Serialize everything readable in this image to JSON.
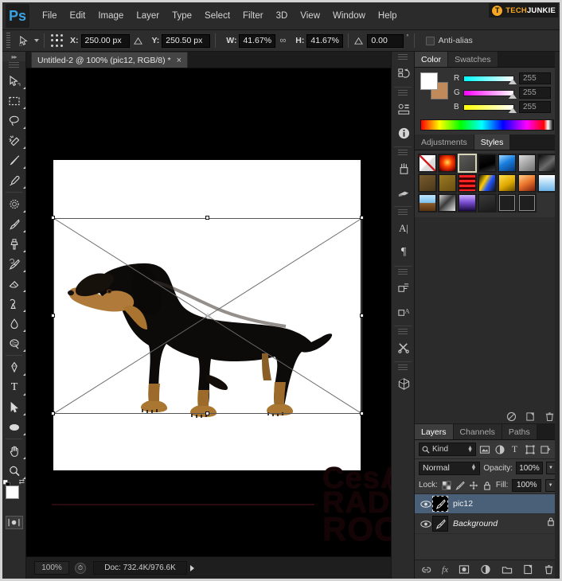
{
  "app": {
    "name": "Adobe Photoshop",
    "logo_text": "Ps",
    "brand_tech": "TECH",
    "brand_junkie": "JUNKIE",
    "brand_mark": "T"
  },
  "menu": {
    "items": [
      "File",
      "Edit",
      "Image",
      "Layer",
      "Type",
      "Select",
      "Filter",
      "3D",
      "View",
      "Window",
      "Help"
    ]
  },
  "options_bar": {
    "tool": "move-tool",
    "x_label": "X:",
    "x_value": "250.00 px",
    "y_label": "Y:",
    "y_value": "250.50 px",
    "w_label": "W:",
    "w_value": "41.67%",
    "h_label": "H:",
    "h_value": "41.67%",
    "link_symbol": "∞",
    "angle_value": "0.00",
    "degree_symbol": "°",
    "antialias_label": "Anti-alias",
    "antialias_checked": false
  },
  "document": {
    "tab_title": "Untitled-2 @ 100% (pic12, RGB/8) *",
    "close_symbol": "×"
  },
  "status_bar": {
    "zoom": "100%",
    "doc_info": "Doc: 732.4K/976.6K"
  },
  "canvas": {
    "watermark_line1": "CesAr",
    "watermark_line2": "RADIO",
    "watermark_line3": "ROCK",
    "image_subject": "dachshund-dog"
  },
  "toolbar": {
    "tools": [
      {
        "name": "move-tool",
        "label": "Move Tool"
      },
      {
        "name": "marquee-tool",
        "label": "Rectangular Marquee Tool"
      },
      {
        "name": "lasso-tool",
        "label": "Lasso Tool"
      },
      {
        "name": "quick-selection-tool",
        "label": "Quick Selection Tool"
      },
      {
        "name": "crop-tool",
        "label": "Crop Tool"
      },
      {
        "name": "eyedropper-tool",
        "label": "Eyedropper Tool"
      },
      {
        "name": "spot-healing-tool",
        "label": "Spot Healing Brush Tool"
      },
      {
        "name": "brush-tool",
        "label": "Brush Tool"
      },
      {
        "name": "clone-stamp-tool",
        "label": "Clone Stamp Tool"
      },
      {
        "name": "history-brush-tool",
        "label": "History Brush Tool"
      },
      {
        "name": "eraser-tool",
        "label": "Eraser Tool"
      },
      {
        "name": "gradient-tool",
        "label": "Gradient Tool"
      },
      {
        "name": "blur-tool",
        "label": "Blur Tool"
      },
      {
        "name": "dodge-tool",
        "label": "Dodge Tool"
      },
      {
        "name": "pen-tool",
        "label": "Pen Tool"
      },
      {
        "name": "type-tool",
        "label": "Horizontal Type Tool"
      },
      {
        "name": "path-selection-tool",
        "label": "Path Selection Tool"
      },
      {
        "name": "ellipse-tool",
        "label": "Ellipse Tool"
      },
      {
        "name": "hand-tool",
        "label": "Hand Tool"
      },
      {
        "name": "zoom-tool",
        "label": "Zoom Tool"
      }
    ],
    "type_glyph": "T",
    "foreground_color": "#ffffff",
    "background_color": "#c08a5a",
    "quick_mask_label": "Edit in Quick Mask Mode"
  },
  "icon_dock": {
    "items": [
      {
        "name": "history-icon"
      },
      {
        "name": "actions-icon"
      },
      {
        "name": "info-icon"
      },
      {
        "name": "brush-presets-icon"
      },
      {
        "name": "brush-settings-icon"
      },
      {
        "name": "character-icon",
        "glyph": "A|"
      },
      {
        "name": "paragraph-icon",
        "glyph": "¶"
      },
      {
        "name": "character-styles-icon"
      },
      {
        "name": "paragraph-styles-icon"
      },
      {
        "name": "tool-presets-icon"
      },
      {
        "name": "3d-icon"
      }
    ]
  },
  "color_panel": {
    "tabs": [
      {
        "label": "Color",
        "active": true
      },
      {
        "label": "Swatches",
        "active": false
      }
    ],
    "channels": [
      {
        "label": "R",
        "value": "255"
      },
      {
        "label": "G",
        "value": "255"
      },
      {
        "label": "B",
        "value": "255"
      }
    ],
    "foreground_color": "#ffffff",
    "background_color": "#c08a5a"
  },
  "styles_panel": {
    "tabs": [
      {
        "label": "Adjustments",
        "active": false
      },
      {
        "label": "Styles",
        "active": true
      }
    ],
    "swatches": [
      {
        "name": "default-none-style",
        "css": "linear-gradient(135deg,#ffffff 0%,#ffffff 45%,#e0e0e0 55%,#cfcfcf 100%)",
        "selected": false,
        "slash": true
      },
      {
        "name": "red-glow-style",
        "css": "radial-gradient(circle at 50% 45%,#ffdd55 0%,#ff4400 38%,#aa1100 72%,#220000 100%)",
        "selected": false
      },
      {
        "name": "gray-bevel-style",
        "css": "linear-gradient(145deg,#5a5a58 0%,#3a3a38 100%)",
        "selected": true
      },
      {
        "name": "black-splatter-style",
        "css": "linear-gradient(160deg,#111111 0%,#000000 60%,#3a3a3a 100%)",
        "selected": false
      },
      {
        "name": "blue-gel-style",
        "css": "linear-gradient(150deg,#9fd8ff 0%,#1a7fe0 45%,#063a7a 100%)",
        "selected": false
      },
      {
        "name": "silver-style",
        "css": "linear-gradient(145deg,#dcdcdc 0%,#9a9a9a 60%,#6e6e6e 100%)",
        "selected": false
      },
      {
        "name": "dark-chrome-style",
        "css": "linear-gradient(140deg,#0a0a0a 0%,#6a6a6a 55%,#111111 100%)",
        "selected": false
      },
      {
        "name": "brown-texture-style",
        "css": "linear-gradient(150deg,#7a5c2e 0%,#4a3718 100%)",
        "selected": false
      },
      {
        "name": "gold-texture-style",
        "css": "linear-gradient(150deg,#9b7a25 0%,#6a5010 100%)",
        "selected": false
      },
      {
        "name": "red-stripes-style",
        "css": "repeating-linear-gradient(to bottom,#ff2222 0 3px,#440000 3px 6px)",
        "selected": false
      },
      {
        "name": "colorful-splash-style",
        "css": "linear-gradient(120deg,#111111 0%,#ffcc00 35%,#2255ff 60%,#111111 100%)",
        "selected": false
      },
      {
        "name": "yellow-bevel-style",
        "css": "linear-gradient(150deg,#ffe14d 0%,#e0a800 55%,#6b4e00 100%)",
        "selected": false
      },
      {
        "name": "sunset-gradient-style",
        "css": "linear-gradient(150deg,#ffd08a 0%,#e8722a 50%,#7a2010 100%)",
        "selected": false
      },
      {
        "name": "light-blue-style",
        "css": "linear-gradient(to bottom,#ffffff 0%,#a9d6f5 55%,#6fb3e8 100%)",
        "selected": false
      },
      {
        "name": "sky-horizon-style",
        "css": "linear-gradient(to bottom,#bfe4ff 0%,#7fc4ef 48%,#8a5a2a 52%,#5a3310 100%)",
        "selected": false
      },
      {
        "name": "noise-texture-style",
        "css": "linear-gradient(135deg,#cfcfcf 0%,#3a3a3a 45%,#e8e8e8 100%)",
        "selected": false
      },
      {
        "name": "purple-gradient-style",
        "css": "linear-gradient(to bottom,#cdb0ff 0%,#7b4fd4 45%,#1a0840 100%)",
        "selected": false
      },
      {
        "name": "dark-square-style",
        "css": "linear-gradient(160deg,#3a3a3a 0%,#1a1a1a 100%)",
        "selected": false
      },
      {
        "name": "outline-square-style",
        "css": "#1f1f1f",
        "selected": false,
        "outline": true
      },
      {
        "name": "outline-square-2-style",
        "css": "#1f1f1f",
        "selected": false,
        "outline": true
      },
      {
        "name": "empty-style",
        "css": "transparent",
        "selected": false,
        "empty": true
      }
    ]
  },
  "layers_panel": {
    "tabs": [
      {
        "label": "Layers",
        "active": true
      },
      {
        "label": "Channels",
        "active": false
      },
      {
        "label": "Paths",
        "active": false
      }
    ],
    "filter_kind": "Kind",
    "blend_mode": "Normal",
    "opacity_label": "Opacity:",
    "opacity_value": "100%",
    "lock_label": "Lock:",
    "fill_label": "Fill:",
    "fill_value": "100%",
    "layers": [
      {
        "name": "pic12",
        "selected": true,
        "visible": true,
        "locked": false,
        "italic": false
      },
      {
        "name": "Background",
        "selected": false,
        "visible": true,
        "locked": true,
        "italic": true
      }
    ],
    "bottom_buttons": [
      {
        "name": "link-layers-button",
        "glyph": "⚭"
      },
      {
        "name": "layer-style-button",
        "glyph": "fx"
      },
      {
        "name": "layer-mask-button",
        "glyph": "▣"
      },
      {
        "name": "adjustment-layer-button",
        "glyph": "◑"
      },
      {
        "name": "new-group-button",
        "glyph": "▰"
      },
      {
        "name": "new-layer-button",
        "glyph": "❐"
      },
      {
        "name": "delete-layer-button",
        "glyph": "Ὕ1"
      }
    ]
  }
}
